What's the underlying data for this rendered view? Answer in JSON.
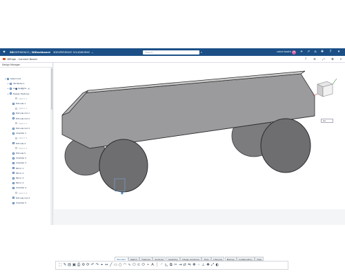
{
  "topbar": {
    "logo_icon": "3ds-compass-icon",
    "brand_3d": "3D",
    "brand_experience": "EXPERIENCE",
    "brand_sep": " | ",
    "brand_dashboard": "3DDashboard",
    "brand_app": "3DEXPERIENCE SOLIDWORKS",
    "search_placeholder": "Search",
    "user_name": "calvin booth",
    "avatar_initials": "CB",
    "bar_color": "#1b4f86"
  },
  "titlebar": {
    "doc_title": "WEdge - Connect Based"
  },
  "panel": {
    "title": "Design Manager",
    "items": [
      {
        "label": "Select List",
        "dim": false,
        "indent": 1
      },
      {
        "label": "3D Model 1",
        "dim": false,
        "indent": 2
      },
      {
        "label": "Axis Systems",
        "dim": false,
        "indent": 2
      },
      {
        "label": "Design Features",
        "dim": false,
        "indent": 2
      },
      {
        "label": "Sketch 1",
        "dim": true,
        "indent": 4
      },
      {
        "label": "Extrude 1",
        "dim": false,
        "indent": 3
      },
      {
        "label": "Sketch 2",
        "dim": true,
        "indent": 4
      },
      {
        "label": "Extrude Cut 1",
        "dim": false,
        "indent": 3
      },
      {
        "label": "Extrude Cut 2",
        "dim": false,
        "indent": 3
      },
      {
        "label": "Sketch 3",
        "dim": true,
        "indent": 4
      },
      {
        "label": "Extrude Cut 3",
        "dim": false,
        "indent": 3
      },
      {
        "label": "Chamfer 1",
        "dim": false,
        "indent": 3
      },
      {
        "label": "Sketch 4",
        "dim": true,
        "indent": 4
      },
      {
        "label": "Extrude 4",
        "dim": false,
        "indent": 3
      },
      {
        "label": "Sketch 5",
        "dim": true,
        "indent": 4
      },
      {
        "label": "Extrude 5",
        "dim": false,
        "indent": 3
      },
      {
        "label": "Chamfer 2",
        "dim": false,
        "indent": 3
      },
      {
        "label": "Chamfer 3",
        "dim": false,
        "indent": 3
      },
      {
        "label": "Mirror 1",
        "dim": false,
        "indent": 3
      },
      {
        "label": "Mirror 2",
        "dim": false,
        "indent": 3
      },
      {
        "label": "Mirror 3",
        "dim": false,
        "indent": 3
      },
      {
        "label": "Mirror 4",
        "dim": false,
        "indent": 3
      },
      {
        "label": "Chamfer 4",
        "dim": false,
        "indent": 3
      },
      {
        "label": "Sketch 6",
        "dim": true,
        "indent": 4
      },
      {
        "label": "Extrude Cut 4",
        "dim": false,
        "indent": 3
      },
      {
        "label": "Chamfer 5",
        "dim": false,
        "indent": 3
      }
    ]
  },
  "viewport": {
    "display_select": "Iso"
  },
  "command_tabs": [
    {
      "label": "Standard",
      "active": true
    },
    {
      "label": "Sketch",
      "active": false
    },
    {
      "label": "Features",
      "active": false
    },
    {
      "label": "Surfaces",
      "active": false
    },
    {
      "label": "Assembly",
      "active": false
    },
    {
      "label": "Design Guidance",
      "active": false
    },
    {
      "label": "Tools",
      "active": false
    },
    {
      "label": "Lifecycle",
      "active": false
    },
    {
      "label": "Markup",
      "active": false
    },
    {
      "label": "Collaboration",
      "active": false
    },
    {
      "label": "View",
      "active": false
    }
  ],
  "toolbar_icons": [
    "select-icon",
    "sketch-icon",
    "folder-icon",
    "save-icon",
    "print-icon",
    "options-icon",
    "rebuild-icon",
    "undo-icon",
    "redo-icon",
    "measure-icon",
    "smart-dimension-icon",
    "line-icon",
    "rectangle-icon",
    "circle-icon",
    "arc-icon",
    "spline-icon",
    "polygon-icon",
    "slot-icon",
    "ellipse-icon",
    "point-icon",
    "text-icon",
    "centerline-icon",
    "fillet-icon",
    "chamfer-icon",
    "offset-icon",
    "trim-icon",
    "extend-icon",
    "convert-icon",
    "mirror-icon",
    "move-icon",
    "pattern-icon",
    "relations-icon",
    "repair-icon",
    "scale-icon",
    "display-icon"
  ],
  "model_colors": {
    "body_top": "#b9b9ba",
    "body_side": "#8f8f91",
    "wheel_face": "#6b6b6d",
    "accent": "#1b4f86"
  }
}
